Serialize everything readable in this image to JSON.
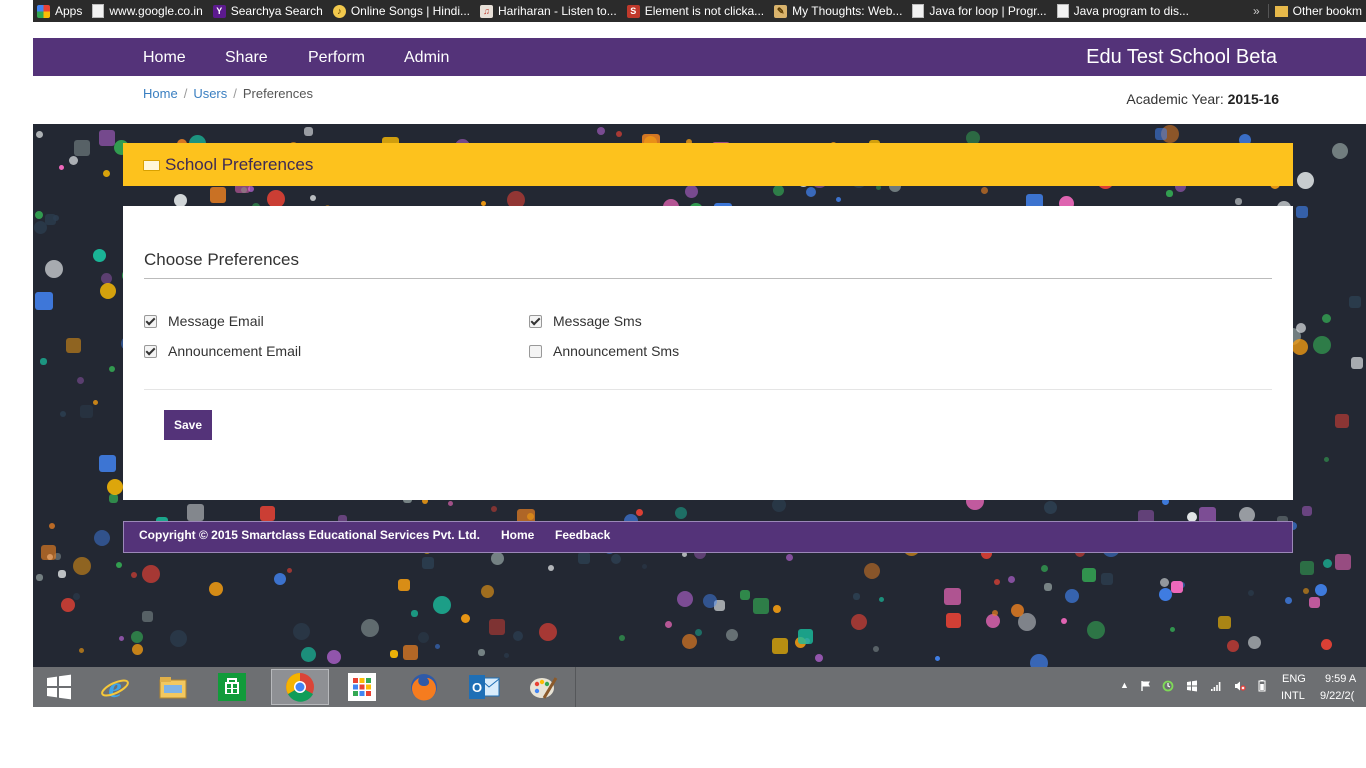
{
  "bookmarks": {
    "items": [
      {
        "label": "Apps",
        "icon": "apps-grid-icon"
      },
      {
        "label": "www.google.co.in",
        "icon": "page-icon"
      },
      {
        "label": "Searchya Search",
        "icon": "yahoo-icon"
      },
      {
        "label": "Online Songs | Hindi...",
        "icon": "songs-icon"
      },
      {
        "label": "Hariharan - Listen to...",
        "icon": "music-icon"
      },
      {
        "label": "Element is not clicka...",
        "icon": "stackoverflow-icon"
      },
      {
        "label": "My Thoughts: Web...",
        "icon": "blog-icon"
      },
      {
        "label": "Java for loop | Progr...",
        "icon": "page-icon"
      },
      {
        "label": "Java program to dis...",
        "icon": "page-icon"
      }
    ],
    "overflow": "»",
    "other": "Other bookm"
  },
  "nav": {
    "items": [
      "Home",
      "Share",
      "Perform",
      "Admin"
    ],
    "brand": "Edu Test School Beta"
  },
  "breadcrumb": {
    "items": [
      "Home",
      "Users",
      "Preferences"
    ],
    "sep": "/"
  },
  "academic_year": {
    "label": "Academic Year:",
    "value": "2015-16"
  },
  "panel": {
    "title": "School Preferences",
    "icon": "id-card-icon"
  },
  "form": {
    "title": "Choose Preferences",
    "options": [
      {
        "label": "Message Email",
        "checked": true
      },
      {
        "label": "Message Sms",
        "checked": true
      },
      {
        "label": "Announcement Email",
        "checked": true
      },
      {
        "label": "Announcement Sms",
        "checked": false
      }
    ],
    "save_label": "Save"
  },
  "footer": {
    "copyright": "Copyright © 2015 Smartclass Educational Services Pvt. Ltd.",
    "links": [
      "Home",
      "Feedback"
    ]
  },
  "taskbar": {
    "apps": [
      "windows-start-icon",
      "internet-explorer-icon",
      "file-explorer-icon",
      "store-icon",
      "chrome-icon",
      "apps-icon",
      "firefox-icon",
      "outlook-icon",
      "paint-icon"
    ],
    "active": "chrome-icon",
    "lang_top": "ENG",
    "lang_bottom": "INTL",
    "time": "9:59 A",
    "date": "9/22/2("
  },
  "colors": {
    "brand_purple": "#543379",
    "panel_yellow": "#fdc21d",
    "link_blue": "#3a7fc1"
  }
}
